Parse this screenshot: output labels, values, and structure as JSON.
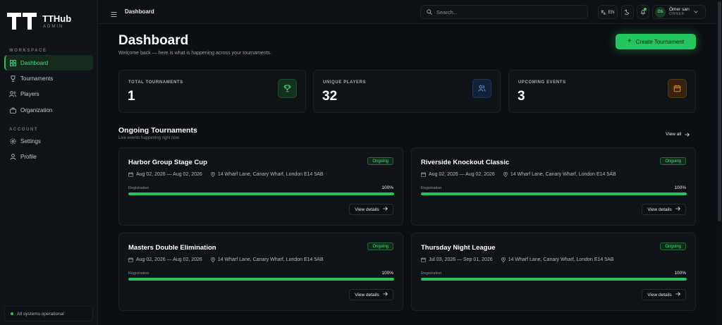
{
  "brand": {
    "name": "TTHub",
    "subtitle": "ADMIN"
  },
  "sidebar": {
    "workspace_label": "WORKSPACE",
    "account_label": "ACCOUNT",
    "items": [
      {
        "label": "Dashboard",
        "icon": "grid-icon",
        "active": true
      },
      {
        "label": "Tournaments",
        "icon": "trophy-icon",
        "active": false
      },
      {
        "label": "Players",
        "icon": "users-icon",
        "active": false
      },
      {
        "label": "Organization",
        "icon": "building-icon",
        "active": false
      },
      {
        "label": "Settings",
        "icon": "gear-icon",
        "active": false
      },
      {
        "label": "Profile",
        "icon": "user-icon",
        "active": false
      }
    ],
    "status": "All systems operational"
  },
  "topbar": {
    "title": "Dashboard",
    "search_placeholder": "Search...",
    "language": "EN",
    "user": {
      "initials": "ÖS",
      "name": "Ömer sarı",
      "role": "OWNER"
    }
  },
  "header": {
    "title": "Dashboard",
    "subtitle": "Welcome back — here is what is happening across your tournaments.",
    "create_button": "Create Tournament"
  },
  "stats": [
    {
      "label": "TOTAL TOURNAMENTS",
      "value": "1",
      "icon": "trophy-icon",
      "color": "#4ade80"
    },
    {
      "label": "UNIQUE PLAYERS",
      "value": "32",
      "icon": "users-icon",
      "color": "#60a5fa"
    },
    {
      "label": "UPCOMING EVENTS",
      "value": "3",
      "icon": "calendar-icon",
      "color": "#f59e0b"
    }
  ],
  "ongoing": {
    "title": "Ongoing Tournaments",
    "subtitle": "Live events happening right now",
    "view_all": "View all",
    "cards": [
      {
        "title": "Harbor Group Stage Cup",
        "badge": "Ongoing",
        "dates": "Aug 02, 2026 — Aug 02, 2026",
        "location": "14 Wharf Lane, Canary Wharf, London E14 5AB",
        "reg_label": "Registration",
        "reg_pct_text": "100%",
        "reg_pct": 100,
        "button": "View details"
      },
      {
        "title": "Riverside Knockout Classic",
        "badge": "Ongoing",
        "dates": "Aug 02, 2026 — Aug 02, 2026",
        "location": "14 Wharf Lane, Canary Wharf, London E14 5AB",
        "reg_label": "Registration",
        "reg_pct_text": "100%",
        "reg_pct": 100,
        "button": "View details"
      },
      {
        "title": "Masters Double Elimination",
        "badge": "Ongoing",
        "dates": "Aug 02, 2026 — Aug 02, 2026",
        "location": "14 Wharf Lane, Canary Wharf, London E14 5AB",
        "reg_label": "Registration",
        "reg_pct_text": "100%",
        "reg_pct": 100,
        "button": "View details"
      },
      {
        "title": "Thursday Night League",
        "badge": "Ongoing",
        "dates": "Jul 03, 2026 — Sep 01, 2026",
        "location": "14 Wharf Lane, Canary Wharf, London E14 5AB",
        "reg_label": "Registration",
        "reg_pct_text": "100%",
        "reg_pct": 100,
        "button": "View details"
      }
    ]
  },
  "colors": {
    "accent": "#22c55e",
    "background": "#0b0e12",
    "card": "#0f1318"
  }
}
